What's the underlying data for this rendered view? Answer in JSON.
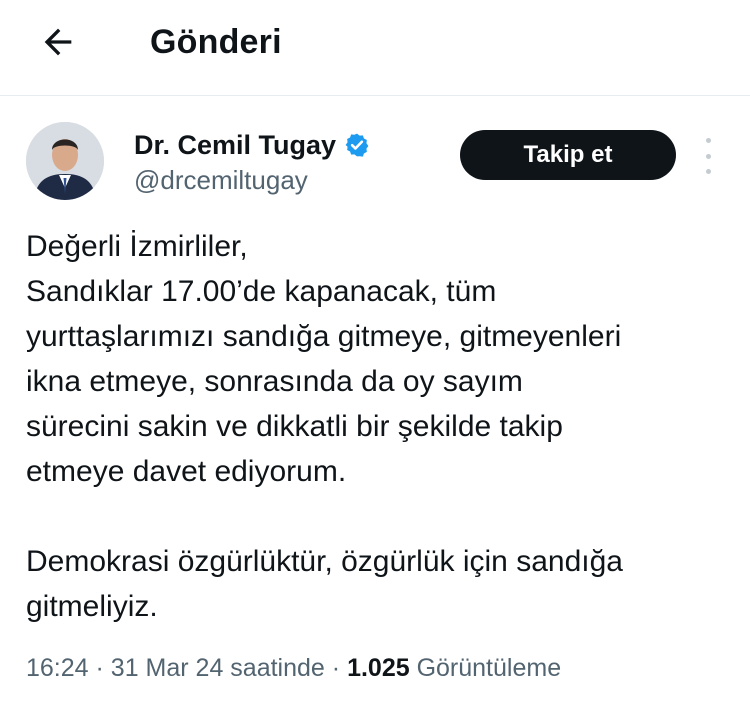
{
  "header": {
    "back_icon": "arrow-left-icon",
    "title": "Gönderi"
  },
  "author": {
    "name": "Dr. Cemil Tugay",
    "handle": "@drcemiltugay",
    "verified_icon": "verified-badge-icon",
    "verified_color": "#1d9bf0"
  },
  "actions": {
    "follow_label": "Takip et",
    "more_icon": "more-vertical-icon"
  },
  "tweet": {
    "lines": [
      "Değerli İzmirliler,",
      "Sandıklar 17.00’de kapanacak, tüm",
      "yurttaşlarımızı sandığa gitmeye, gitmeyenleri",
      "ikna etmeye, sonrasında da oy sayım",
      "sürecini sakin ve dikkatli bir şekilde takip",
      "etmeye davet ediyorum.",
      "",
      "Demokrasi özgürlüktür, özgürlük için sandığa",
      "gitmeliyiz."
    ]
  },
  "meta": {
    "time": "16:24",
    "separator": "·",
    "date": "31 Mar 24 saatinde",
    "view_count": "1.025",
    "view_label": "Görüntüleme"
  },
  "colors": {
    "text_primary": "#0f1419",
    "text_secondary": "#536471",
    "follow_button_bg": "#0f1419",
    "follow_button_text": "#ffffff"
  }
}
